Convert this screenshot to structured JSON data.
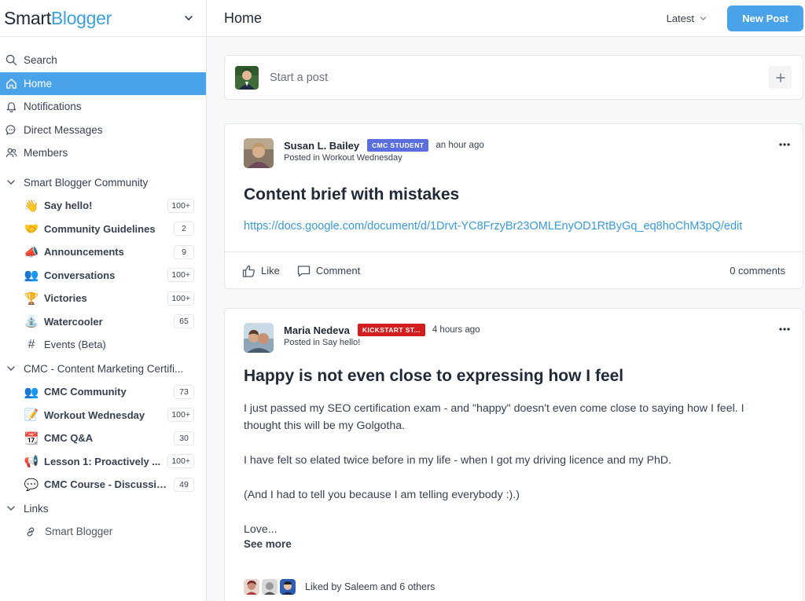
{
  "brand": {
    "part1": "Smart",
    "part2": "Blogger"
  },
  "nav": [
    {
      "label": "Search",
      "icon": "search-icon"
    },
    {
      "label": "Home",
      "icon": "home-icon",
      "active": true
    },
    {
      "label": "Notifications",
      "icon": "bell-icon"
    },
    {
      "label": "Direct Messages",
      "icon": "chat-icon"
    },
    {
      "label": "Members",
      "icon": "members-icon"
    }
  ],
  "sections": [
    {
      "title": "Smart Blogger Community",
      "items": [
        {
          "emoji": "👋",
          "name": "Say hello!",
          "count": "100+"
        },
        {
          "emoji": "🤝",
          "name": "Community Guidelines",
          "count": "2"
        },
        {
          "emoji": "📣",
          "name": "Announcements",
          "count": "9"
        },
        {
          "emoji": "👥",
          "name": "Conversations",
          "count": "100+"
        },
        {
          "emoji": "🏆",
          "name": "Victories",
          "count": "100+"
        },
        {
          "emoji": "⛲",
          "name": "Watercooler",
          "count": "65"
        },
        {
          "emoji": "#",
          "name": "Events (Beta)",
          "count": ""
        }
      ]
    },
    {
      "title": "CMC - Content Marketing Certifi...",
      "items": [
        {
          "emoji": "👥",
          "name": "CMC Community",
          "count": "73"
        },
        {
          "emoji": "📝",
          "name": "Workout Wednesday",
          "count": "100+"
        },
        {
          "emoji": "📆",
          "name": "CMC Q&A",
          "count": "30"
        },
        {
          "emoji": "📢",
          "name": "Lesson 1: Proactively ...",
          "count": "100+"
        },
        {
          "emoji": "💬",
          "name": "CMC Course - Discussio...",
          "count": "49"
        }
      ]
    }
  ],
  "links": {
    "title": "Links",
    "items": [
      {
        "name": "Smart Blogger"
      }
    ]
  },
  "header": {
    "title": "Home",
    "sort_label": "Latest",
    "new_post_label": "New Post"
  },
  "composer": {
    "placeholder": "Start a post"
  },
  "posts": [
    {
      "author": "Susan L. Bailey",
      "badge": "CMC STUDENT",
      "badge_color": "#5b6ee0",
      "time": "an hour ago",
      "posted_in": "Posted in Workout Wednesday",
      "title": "Content brief with mistakes",
      "link": "https://docs.google.com/document/d/1Drvt-YC8FrzyBr23OMLEnyOD1RtByGq_eq8hoChM3pQ/edit",
      "like_label": "Like",
      "comment_label": "Comment",
      "comments_count": "0 comments"
    },
    {
      "author": "Maria Nedeva",
      "badge": "KICKSTART ST...",
      "badge_color": "#d41e1e",
      "time": "4 hours ago",
      "posted_in": "Posted in Say hello!",
      "title": "Happy is not even close to expressing how I feel",
      "paragraphs": [
        "I just passed my SEO certification exam - and \"happy\" doesn't even come close to saying how I feel. I thought this will be my Golgotha.",
        "I have felt so elated twice before in my life - when I got my driving licence and my PhD.",
        "(And I had to tell you because I am telling everybody :).)",
        "Love..."
      ],
      "see_more": "See more",
      "liked_by": "Liked by Saleem and 6 others"
    }
  ],
  "colors": {
    "accent": "#4aa3e8",
    "link": "#3b9ad9",
    "brand_blue": "#3aa1dc"
  }
}
